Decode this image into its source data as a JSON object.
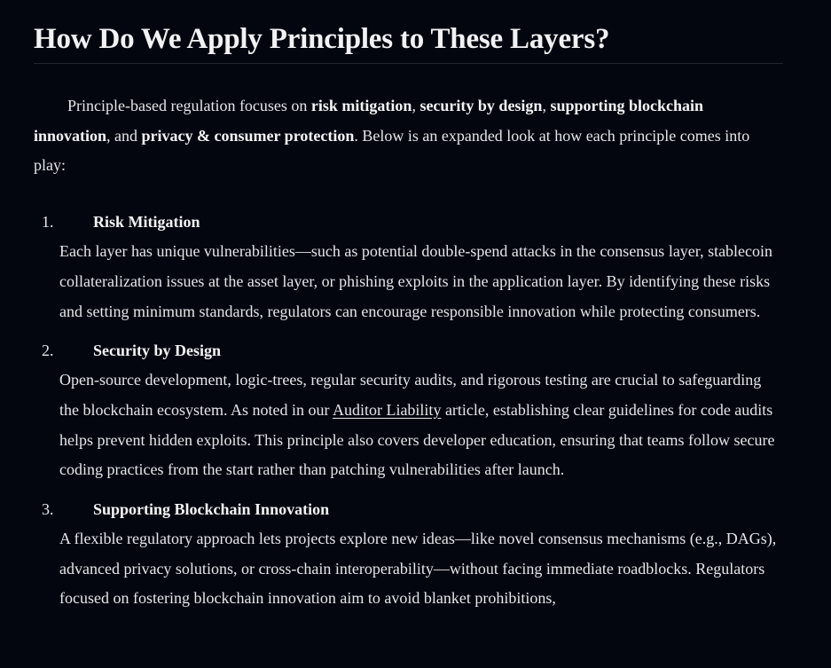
{
  "article": {
    "heading": "How Do We Apply Principles to These Layers?",
    "intro": {
      "t1": "Principle-based regulation focuses on ",
      "b1": "risk mitigation",
      "t2": ", ",
      "b2": "security by design",
      "t3": ", ",
      "b3": "supporting blockchain innovation",
      "t4": ", and ",
      "b4": "privacy & consumer protection",
      "t5": ". Below is an expanded look at how each principle comes into play:"
    },
    "items": [
      {
        "number": "1.",
        "title": "Risk Mitigation",
        "body": "Each layer has unique vulnerabilities—such as potential double-spend attacks in the consensus layer, stablecoin collateralization issues at the asset layer, or phishing exploits in the application layer. By identifying these risks and setting minimum standards, regulators can encourage responsible innovation while protecting consumers."
      },
      {
        "number": "2.",
        "title": "Security by Design",
        "body_before": "Open-source development, logic-trees, regular security audits, and rigorous testing are crucial to safeguarding the blockchain ecosystem. As noted in our ",
        "link": "Auditor Liability",
        "body_after": " article, establishing clear guidelines for code audits helps prevent hidden exploits. This principle also covers developer education, ensuring that teams follow secure coding practices from the start rather than patching vulnerabilities after launch."
      },
      {
        "number": "3.",
        "title": "Supporting Blockchain Innovation",
        "body": "A flexible regulatory approach lets projects explore new ideas—like novel consensus mechanisms (e.g., DAGs), advanced privacy solutions, or cross-chain interoperability—without facing immediate roadblocks. Regulators focused on fostering blockchain innovation aim to avoid blanket prohibitions,"
      }
    ]
  }
}
